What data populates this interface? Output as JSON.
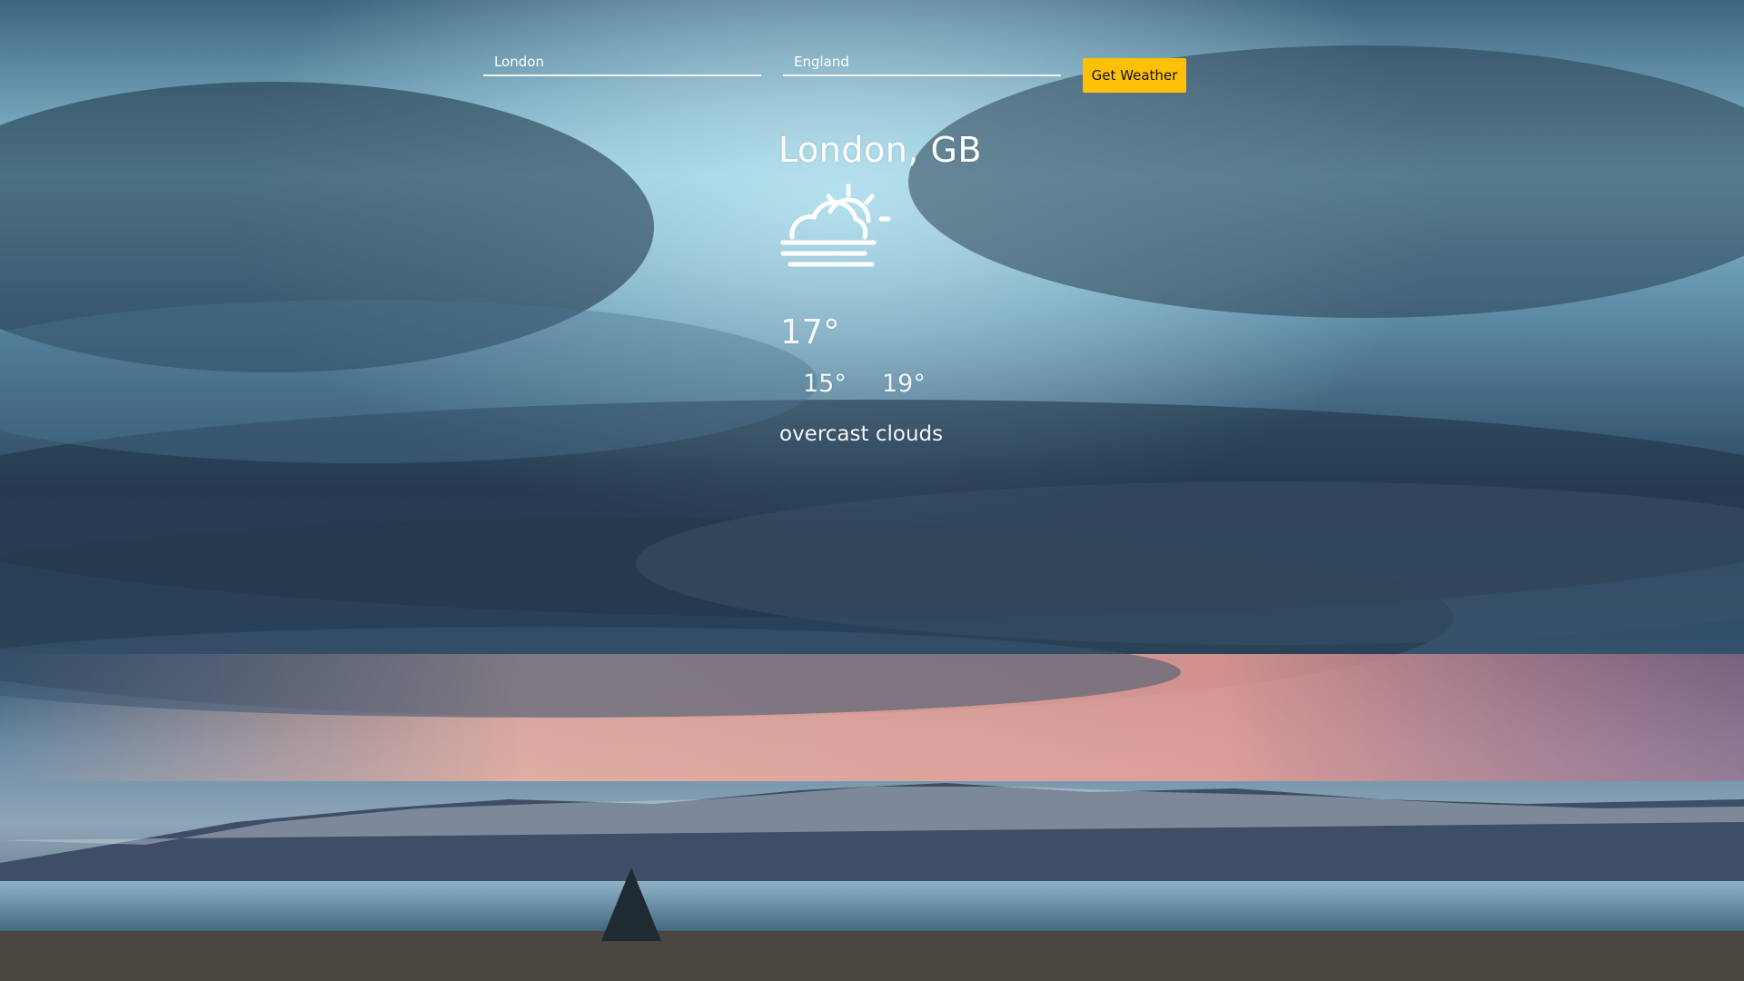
{
  "form": {
    "city_placeholder": "London",
    "country_placeholder": "England",
    "submit_label": "Get Weather",
    "submit_color": "#ffc107"
  },
  "weather": {
    "location": "London, GB",
    "icon": "sun-behind-clouds-fog-icon",
    "current_temp": "17°",
    "min_temp": "15°",
    "max_temp": "19°",
    "description": "overcast clouds"
  },
  "background": {
    "scene": "stormy-sky-mountains-lake",
    "sky_colors": [
      "#2a4862",
      "#8cc4d8",
      "#e9a59a"
    ]
  }
}
